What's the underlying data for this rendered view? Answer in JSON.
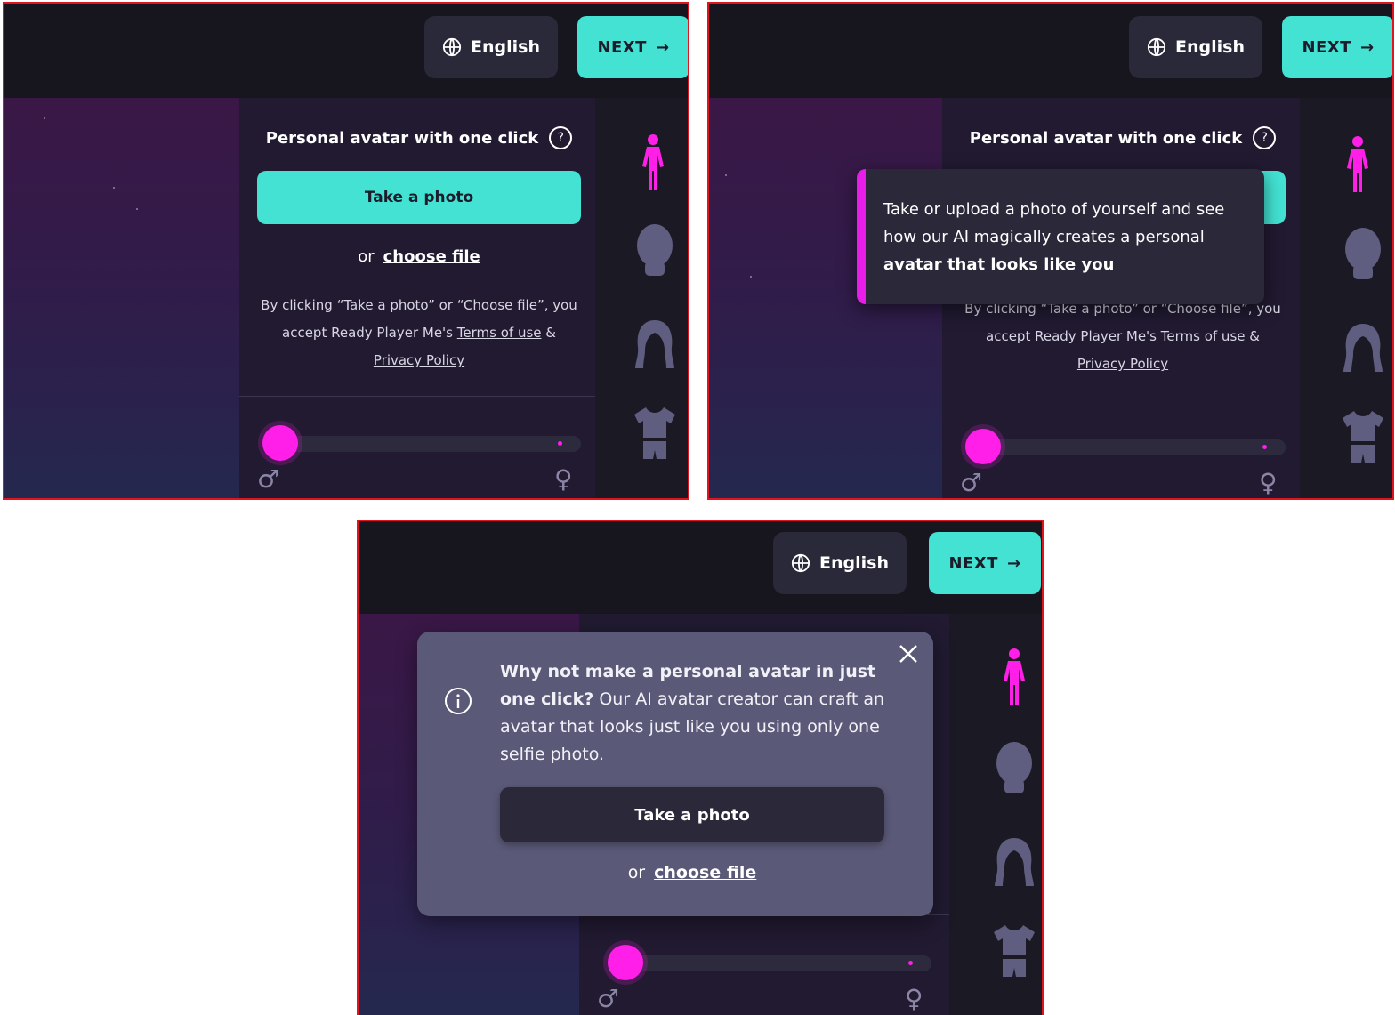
{
  "header": {
    "language_label": "English",
    "next_label": "NEXT",
    "next_arrow": "→"
  },
  "photo_card": {
    "title": "Personal avatar with one click",
    "help_symbol": "?",
    "take_photo_label": "Take a photo",
    "or_label": "or",
    "choose_file_label": "choose file",
    "legal_prefix": "By clicking “Take a photo” or “Choose file”, you accept Ready Player Me's",
    "terms_label": "Terms of use",
    "legal_amp": "&",
    "privacy_label": "Privacy Policy"
  },
  "tooltip": {
    "text_plain": "Take or upload a photo of yourself and see how our AI magically creates a personal",
    "text_bold": "avatar that looks like you",
    "partial_legal": "By clicking “Take a photo” or “Choose file”, you"
  },
  "modal": {
    "info_symbol": "i",
    "close_symbol": "✕",
    "headline_bold": "Why not make a personal avatar in just one click?",
    "headline_rest": "Our AI avatar creator can craft an avatar that looks just like you using only one selfie photo.",
    "take_photo_label": "Take a photo",
    "or_label": "or",
    "choose_file_label": "choose file"
  },
  "gender_slider": {
    "male_symbol": "♂",
    "female_symbol": "♀",
    "value": 0
  },
  "sidebar_icons": [
    "full-body-icon",
    "head-icon",
    "hair-icon",
    "outfit-icon"
  ],
  "colors": {
    "accent_teal": "#43e2d3",
    "accent_magenta": "#ff1fe9",
    "panel_dark": "#17161f",
    "border_red": "#e0141e"
  }
}
